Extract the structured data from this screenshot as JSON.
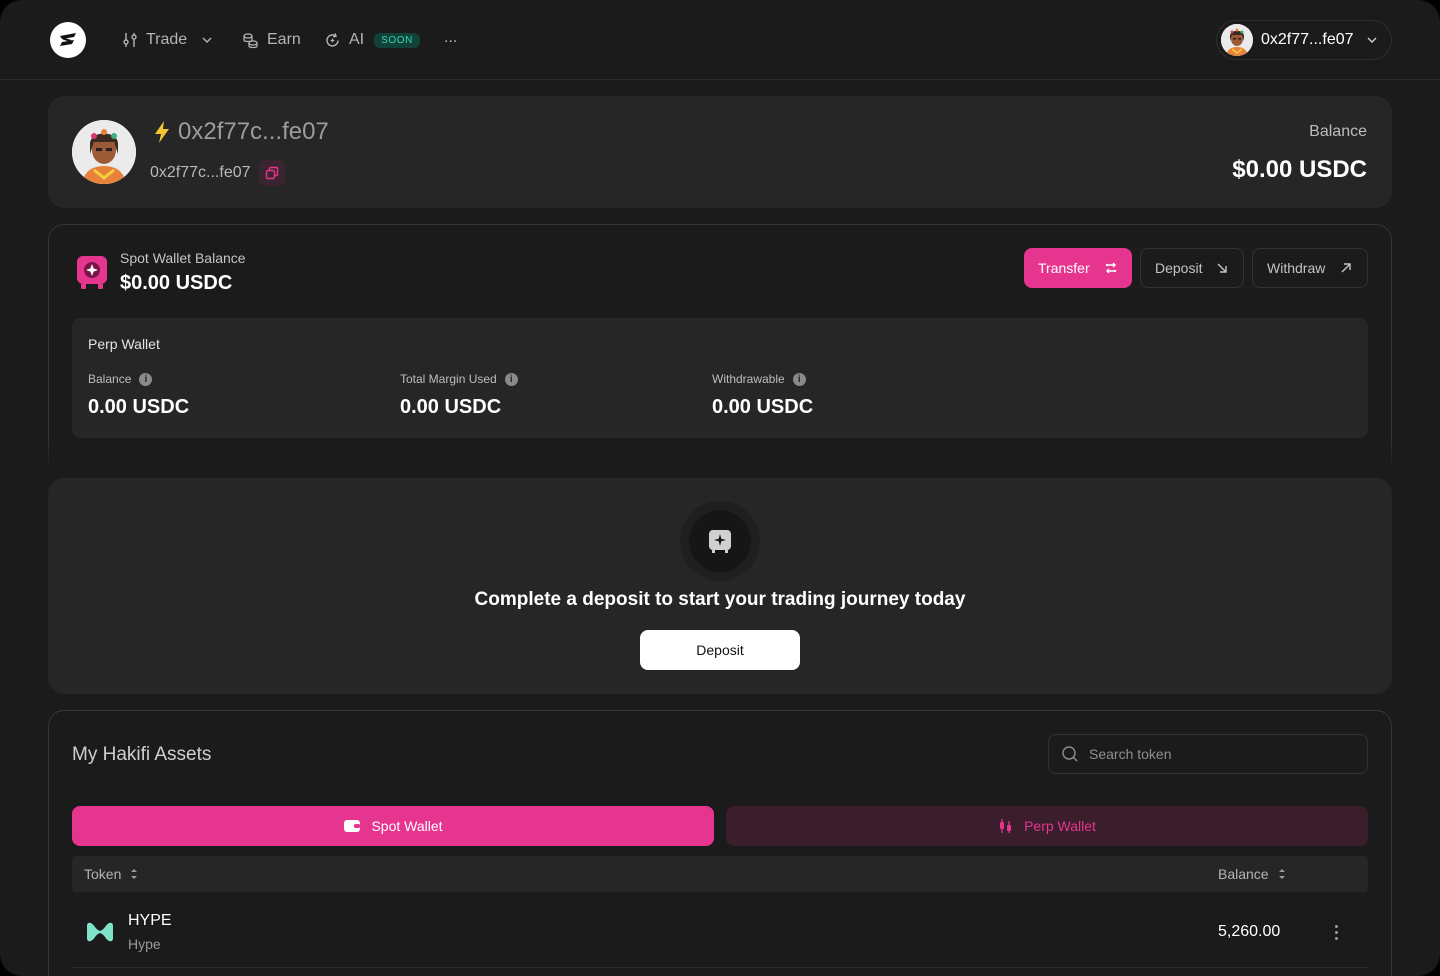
{
  "nav": {
    "items": [
      {
        "label": "Trade",
        "icon": "sliders-icon",
        "has_dropdown": true
      },
      {
        "label": "Earn",
        "icon": "coins-icon"
      },
      {
        "label": "AI",
        "icon": "ai-refresh-icon",
        "badge": "SOON"
      }
    ],
    "more_label": "...",
    "account": {
      "address": "0x2f77...fe07",
      "icon": "chevron-down-icon"
    }
  },
  "profile": {
    "display_name": "0x2f77c...fe07",
    "address": "0x2f77c...fe07",
    "balance_label": "Balance",
    "balance_value": "$0.00 USDC"
  },
  "spot_wallet": {
    "label": "Spot Wallet Balance",
    "value": "$0.00 USDC",
    "actions": [
      {
        "label": "Transfer",
        "icon": "transfer-icon"
      },
      {
        "label": "Deposit",
        "icon": "arrow-down-right-icon"
      },
      {
        "label": "Withdraw",
        "icon": "arrow-up-right-icon"
      }
    ]
  },
  "perp_wallet": {
    "title": "Perp Wallet",
    "stats": [
      {
        "label": "Balance",
        "value": "0.00 USDC"
      },
      {
        "label": "Total Margin Used",
        "value": "0.00 USDC"
      },
      {
        "label": "Withdrawable",
        "value": "0.00 USDC"
      }
    ]
  },
  "deposit_cta": {
    "message": "Complete a deposit to start your trading journey today",
    "button_label": "Deposit"
  },
  "assets": {
    "title": "My Hakifi Assets",
    "search_placeholder": "Search token",
    "tabs": [
      {
        "label": "Spot Wallet",
        "active": true
      },
      {
        "label": "Perp Wallet",
        "active": false
      }
    ],
    "columns": [
      "Token",
      "Balance"
    ],
    "rows": [
      {
        "symbol": "HYPE",
        "name": "Hype",
        "balance": "5,260.00"
      }
    ]
  },
  "colors": {
    "accent": "#e5358f",
    "background": "#1b1b1b",
    "card": "#262626",
    "hype_token": "#7ee3c9"
  }
}
